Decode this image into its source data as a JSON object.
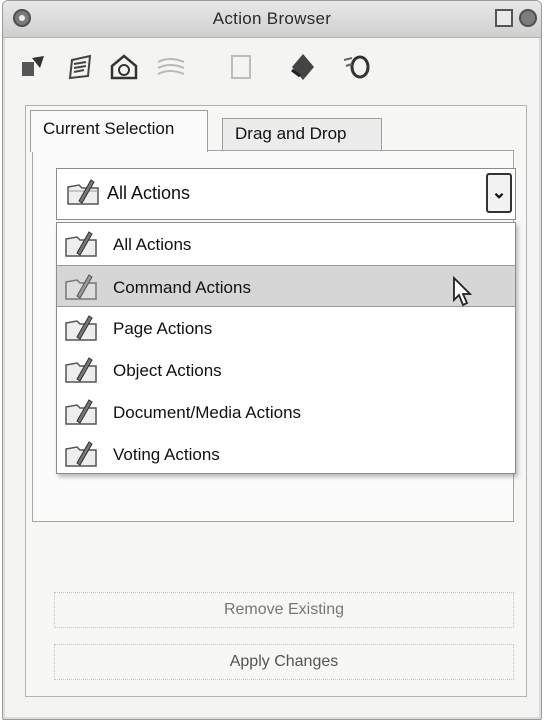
{
  "window": {
    "title": "Action Browser"
  },
  "toolbar": {
    "icons": [
      "action-icon",
      "script-icon",
      "page-icon",
      "stack-icon",
      "blank-icon",
      "effect-icon",
      "link-icon"
    ]
  },
  "tabs": [
    {
      "label": "Current Selection",
      "active": true
    },
    {
      "label": "Drag and Drop",
      "active": false
    }
  ],
  "filter": {
    "selected": "All Actions",
    "options": [
      {
        "label": "All Actions"
      },
      {
        "label": "Command Actions",
        "highlighted": true
      },
      {
        "label": "Page Actions"
      },
      {
        "label": "Object Actions"
      },
      {
        "label": "Document/Media Actions"
      },
      {
        "label": "Voting Actions"
      }
    ]
  },
  "buttons": {
    "remove_label": "Remove Existing",
    "apply_label": "Apply Changes"
  }
}
